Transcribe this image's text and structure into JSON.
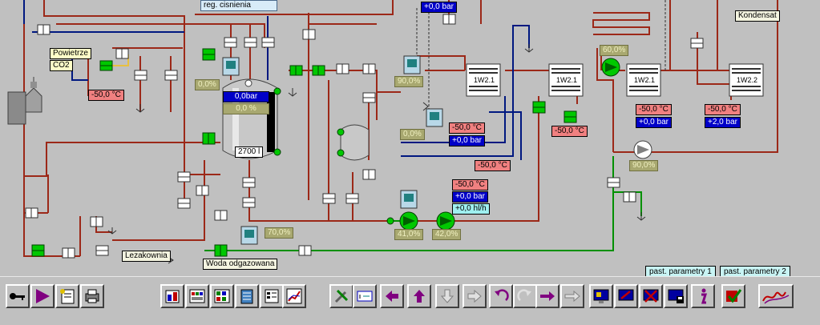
{
  "process": {
    "tank_name": "reg. cisnienia",
    "labels": {
      "air": "Powietrze",
      "co2": "CO2",
      "cellar": "Lezakownia",
      "degassed_water": "Woda odgazowana",
      "condensate": "Kondensat"
    },
    "tank": {
      "pressure": "0,0bar",
      "level_pct": "0,0 %",
      "volume": "2700 l",
      "valve_pct": "0,0%"
    },
    "top_pressure": "+0,0 bar",
    "temp_left": "-50,0 °C",
    "valve_pct_a": "90,0%",
    "valve_pct_b": "0,0%",
    "valve_pct_c": "70,0%",
    "mid_temp": "-50,0 °C",
    "mid_pressure": "+0,0 bar",
    "mid_temp_2": "-50,0 °C",
    "pump_group": {
      "temp": "-50,0 °C",
      "pressure": "+0,0 bar",
      "flow": "+0,0 hl/h",
      "pump1_pct": "41,0%",
      "pump2_pct": "42,0%"
    },
    "heat_exchangers": [
      "1W2.1",
      "1W2.1",
      "1W2.1",
      "1W2.2"
    ],
    "right_pump_pct": "60,0%",
    "hx_temp_a": "-50,0 °C",
    "hx_temp_b": "-50,0 °C",
    "hx_pressure_b": "+0,0 bar",
    "hx_temp_c": "-50,0 °C",
    "hx_pressure_c": "+2,0 bar",
    "fan_pct": "90,0%"
  },
  "param_buttons": [
    "past. parametry 1",
    "past. parametry 2"
  ],
  "toolbar": {
    "icons": [
      "key-icon",
      "play-icon",
      "notepad-icon",
      "printer-icon",
      "report-icon",
      "gkc-icon",
      "grid-icon",
      "panel-icon",
      "trend-list-icon",
      "trend-chart-icon",
      "tools-icon",
      "text-edit-icon",
      "arrow-left-icon",
      "arrow-up-icon",
      "arrow-down-icon",
      "arrow-right-icon",
      "undo-icon",
      "redo-icon",
      "move-right-icon",
      "move-right-2-icon",
      "screen-icon",
      "screen-edit-icon",
      "screen-delete-icon",
      "screen-save-icon",
      "info-icon",
      "check-icon",
      "signature-icon"
    ]
  },
  "colors": {
    "background": "#c0c0c0",
    "pipe": "#9c2818",
    "cold_pipe": "#001880",
    "water_pipe": "#009000",
    "valve_on": "#00c800"
  }
}
